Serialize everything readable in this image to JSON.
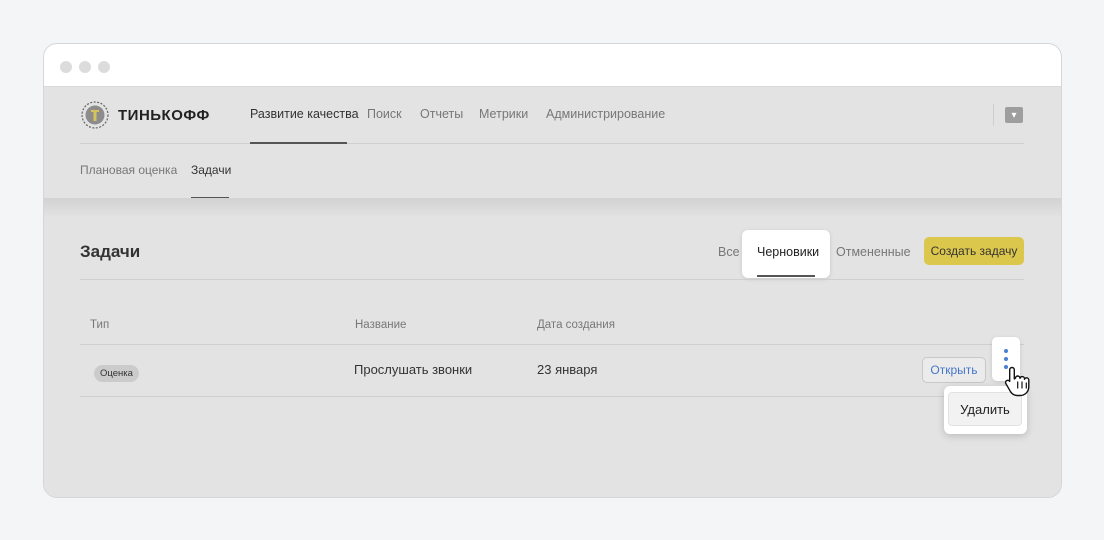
{
  "brand": {
    "name": "ТИНЬКОФФ"
  },
  "topnav": {
    "items": [
      {
        "label": "Развитие качества",
        "active": true
      },
      {
        "label": "Поиск",
        "active": false
      },
      {
        "label": "Отчеты",
        "active": false
      },
      {
        "label": "Метрики",
        "active": false
      },
      {
        "label": "Администрирование",
        "active": false
      }
    ],
    "user_icon": "chevron-down-icon"
  },
  "subnav": {
    "items": [
      {
        "label": "Плановая оценка",
        "active": false
      },
      {
        "label": "Задачи",
        "active": true
      }
    ]
  },
  "page": {
    "title": "Задачи",
    "filters": [
      {
        "label": "Все",
        "active": false
      },
      {
        "label": "Черновики",
        "active": true
      },
      {
        "label": "Отмененные",
        "active": false
      }
    ],
    "create_button": "Создать задачу"
  },
  "table": {
    "columns": [
      "Тип",
      "Название",
      "Дата создания"
    ],
    "rows": [
      {
        "type": "Оценка",
        "name": "Прослушать звонки",
        "date": "23 января",
        "action": "Открыть"
      }
    ]
  },
  "row_menu": {
    "items": [
      "Удалить"
    ]
  },
  "colors": {
    "accent": "#dcc74d",
    "link": "#4577c9",
    "kebab": "#4a7fd4"
  }
}
